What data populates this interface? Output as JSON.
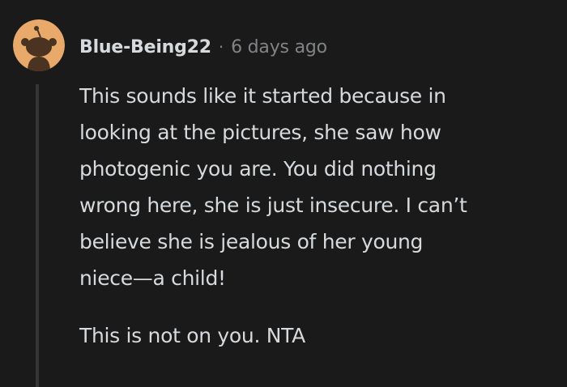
{
  "comment": {
    "username": "Blue-Being22",
    "separator": "·",
    "timestamp": "6 days ago",
    "avatar_icon": "reddit-snoo-avatar-icon",
    "colors": {
      "background": "#1a1a1b",
      "text": "#d7dadc",
      "muted": "#818384",
      "avatar_bg": "#e8a96a",
      "thread_line": "#343536"
    },
    "body": {
      "paragraph1_lines": [
        "This sounds like it started because in",
        "looking at the pictures, she saw how",
        "photogenic you are. You did nothing",
        "wrong here, she is just insecure. I can’t",
        "believe she is jealous of her young",
        "niece—a child!"
      ],
      "paragraph2": "This is not on you. NTA"
    }
  }
}
